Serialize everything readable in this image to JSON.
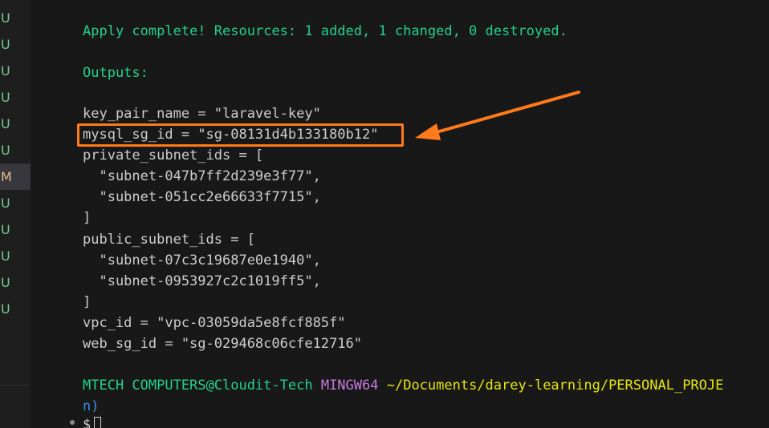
{
  "sidebar": {
    "statuses": [
      "U",
      "U",
      "U",
      "U",
      "U",
      "U",
      "M",
      "U",
      "U",
      "U",
      "U",
      "U"
    ]
  },
  "terminal": {
    "apply_line": "Apply complete! Resources: 1 added, 1 changed, 0 destroyed.",
    "outputs_label": "Outputs:",
    "output_lines": [
      "key_pair_name = \"laravel-key\"",
      "mysql_sg_id = \"sg-08131d4b133180b12\"",
      "private_subnet_ids = [",
      "  \"subnet-047b7ff2d239e3f77\",",
      "  \"subnet-051cc2e66633f7715\",",
      "]",
      "public_subnet_ids = [",
      "  \"subnet-07c3c19687e0e1940\",",
      "  \"subnet-0953927c2c1019ff5\",",
      "]",
      "vpc_id = \"vpc-03059da5e8fcf885f\"",
      "web_sg_id = \"sg-029468c06cfe12716\""
    ],
    "prompt": {
      "user_host": "MTECH COMPUTERS@Cloudit-Tech",
      "shell": "MINGW64",
      "path": "~/Documents/darey-learning/PERSONAL_PROJE",
      "branch_tail": "n)",
      "symbol": "$"
    }
  },
  "annotation": {
    "color": "#ff7a1a",
    "highlighted_output": "mysql_sg_id"
  }
}
